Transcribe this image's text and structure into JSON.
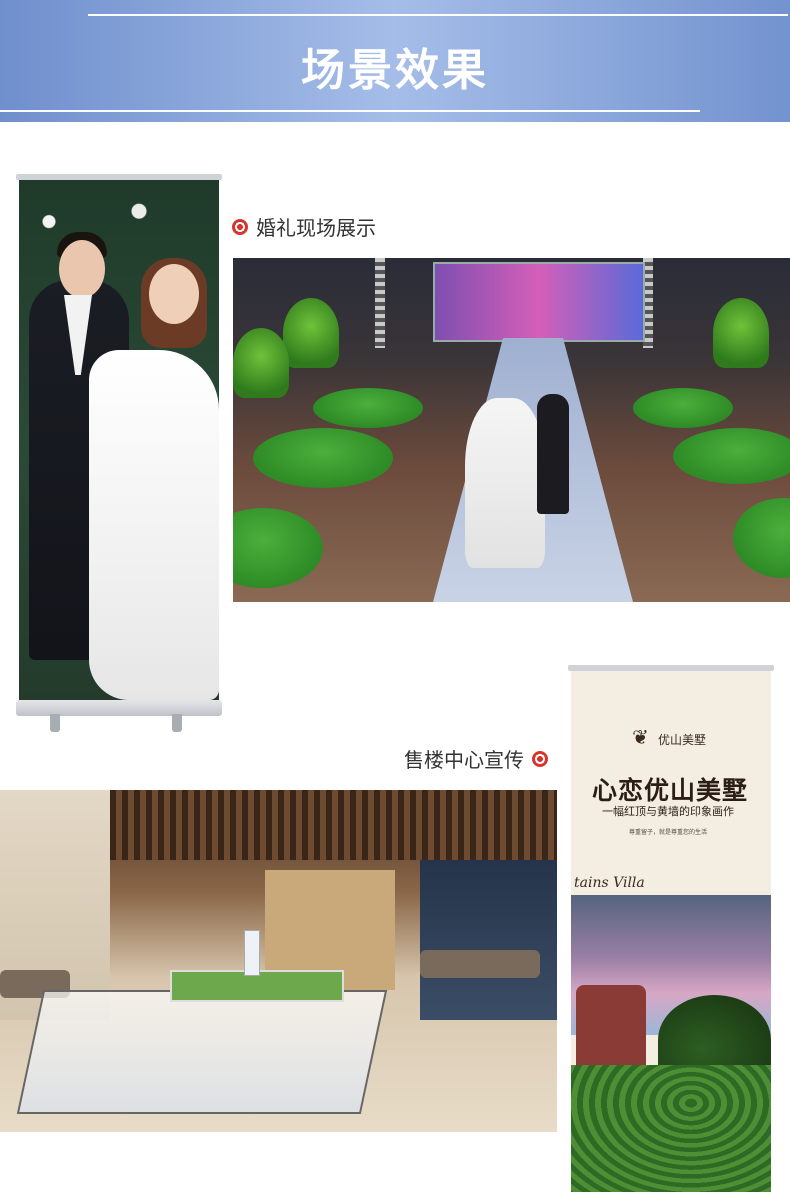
{
  "header": {
    "title": "场景效果"
  },
  "sections": {
    "wedding_label": "婚礼现场展示",
    "sales_label": "售楼中心宣传"
  },
  "villa_poster": {
    "logo_text": "优山美墅",
    "headline": "心恋优山美墅",
    "subline": "一幅红顶与黄墙的印象画作",
    "small_text": "尊重留子，就是尊重您的生活",
    "brand_english": "tains Villa"
  },
  "colors": {
    "header_blue": "#7b97d2",
    "target_red": "#d9332a"
  },
  "icons": {
    "bullet": "target-icon"
  }
}
